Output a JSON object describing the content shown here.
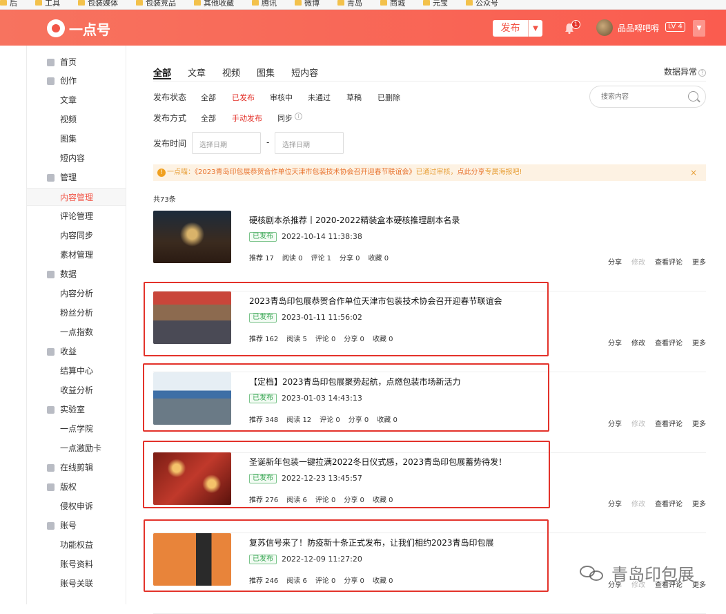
{
  "bookmarks": [
    "后",
    "工具",
    "包装媒体",
    "包装竞品",
    "其他收藏",
    "腾讯",
    "微博",
    "青岛",
    "商城",
    "元宝",
    "公众号"
  ],
  "header": {
    "logo_text": "一点号",
    "publish_label": "发布",
    "notification_count": "1",
    "username": "品品嘚吧嘚",
    "level": "LV 4"
  },
  "sidebar": {
    "items": [
      {
        "label": "首页",
        "type": "group",
        "icon": "home-icon"
      },
      {
        "label": "创作",
        "type": "group",
        "icon": "pen-icon"
      },
      {
        "label": "文章",
        "type": "sub"
      },
      {
        "label": "视频",
        "type": "sub"
      },
      {
        "label": "图集",
        "type": "sub"
      },
      {
        "label": "短内容",
        "type": "sub"
      },
      {
        "label": "管理",
        "type": "group",
        "icon": "grid-icon"
      },
      {
        "label": "内容管理",
        "type": "sub",
        "active": true
      },
      {
        "label": "评论管理",
        "type": "sub"
      },
      {
        "label": "内容同步",
        "type": "sub"
      },
      {
        "label": "素材管理",
        "type": "sub"
      },
      {
        "label": "数据",
        "type": "group",
        "icon": "bar-chart-icon"
      },
      {
        "label": "内容分析",
        "type": "sub"
      },
      {
        "label": "粉丝分析",
        "type": "sub"
      },
      {
        "label": "一点指数",
        "type": "sub"
      },
      {
        "label": "收益",
        "type": "group",
        "icon": "coin-icon"
      },
      {
        "label": "结算中心",
        "type": "sub"
      },
      {
        "label": "收益分析",
        "type": "sub"
      },
      {
        "label": "实验室",
        "type": "group",
        "icon": "flask-icon"
      },
      {
        "label": "一点学院",
        "type": "sub"
      },
      {
        "label": "一点激励卡",
        "type": "sub"
      },
      {
        "label": "在线剪辑",
        "type": "group",
        "icon": "clip-icon"
      },
      {
        "label": "版权",
        "type": "group",
        "icon": "shield-icon"
      },
      {
        "label": "侵权申诉",
        "type": "sub"
      },
      {
        "label": "账号",
        "type": "group",
        "icon": "user-icon"
      },
      {
        "label": "功能权益",
        "type": "sub"
      },
      {
        "label": "账号资料",
        "type": "sub"
      },
      {
        "label": "账号关联",
        "type": "sub"
      }
    ]
  },
  "tabs": [
    "全部",
    "文章",
    "视频",
    "图集",
    "短内容"
  ],
  "data_anomaly": "数据异常",
  "filters": {
    "status_label": "发布状态",
    "status_options": [
      "全部",
      "已发布",
      "审核中",
      "未通过",
      "草稿",
      "已删除"
    ],
    "method_label": "发布方式",
    "method_options": [
      "全部",
      "手动发布",
      "同步"
    ],
    "time_label": "发布时间",
    "date_placeholder": "选择日期",
    "search_placeholder": "搜索内容"
  },
  "notice": {
    "prefix": "一点喵：",
    "title": "《2023青岛印包展恭贺合作单位天津市包装技术协会召开迎春节联谊会》",
    "middle": "已通过审核，",
    "cta": "点此分享",
    "suffix": "专属海报吧!"
  },
  "total": "共73条",
  "articles": [
    {
      "title": "硬核剧本杀推荐丨2020-2022精装盒本硬核推理剧本名录",
      "status": "已发布",
      "time": "2022-10-14 11:38:38",
      "stats": [
        "推荐 17",
        "阅读 0",
        "评论 1",
        "分享 0",
        "收藏 0"
      ],
      "edit_enabled": false
    },
    {
      "title": "2023青岛印包展恭贺合作单位天津市包装技术协会召开迎春节联谊会",
      "status": "已发布",
      "time": "2023-01-11 11:56:02",
      "stats": [
        "推荐 162",
        "阅读 5",
        "评论 0",
        "分享 0",
        "收藏 0"
      ],
      "edit_enabled": true
    },
    {
      "title": "【定档】2023青岛印包展聚势起航，点燃包装市场新活力",
      "status": "已发布",
      "time": "2023-01-03 14:43:13",
      "stats": [
        "推荐 348",
        "阅读 12",
        "评论 0",
        "分享 0",
        "收藏 0"
      ],
      "edit_enabled": false
    },
    {
      "title": "圣诞新年包装一键拉满2022冬日仪式感，2023青岛印包展蓄势待发！",
      "status": "已发布",
      "time": "2022-12-23 13:45:57",
      "stats": [
        "推荐 276",
        "阅读 6",
        "评论 0",
        "分享 0",
        "收藏 0"
      ],
      "edit_enabled": false
    },
    {
      "title": "复苏信号来了！防疫新十条正式发布，让我们相约2023青岛印包展",
      "status": "已发布",
      "time": "2022-12-09 11:27:20",
      "stats": [
        "推荐 246",
        "阅读 6",
        "评论 0",
        "分享 0",
        "收藏 0"
      ],
      "edit_enabled": false
    }
  ],
  "actions": {
    "share": "分享",
    "edit": "修改",
    "comments": "查看评论",
    "more": "更多"
  },
  "watermark": "青岛印包展",
  "colors": {
    "brand": "#f25648",
    "active": "#e3322a",
    "published": "#3aa655",
    "notice_bg": "#fdf2e3"
  }
}
